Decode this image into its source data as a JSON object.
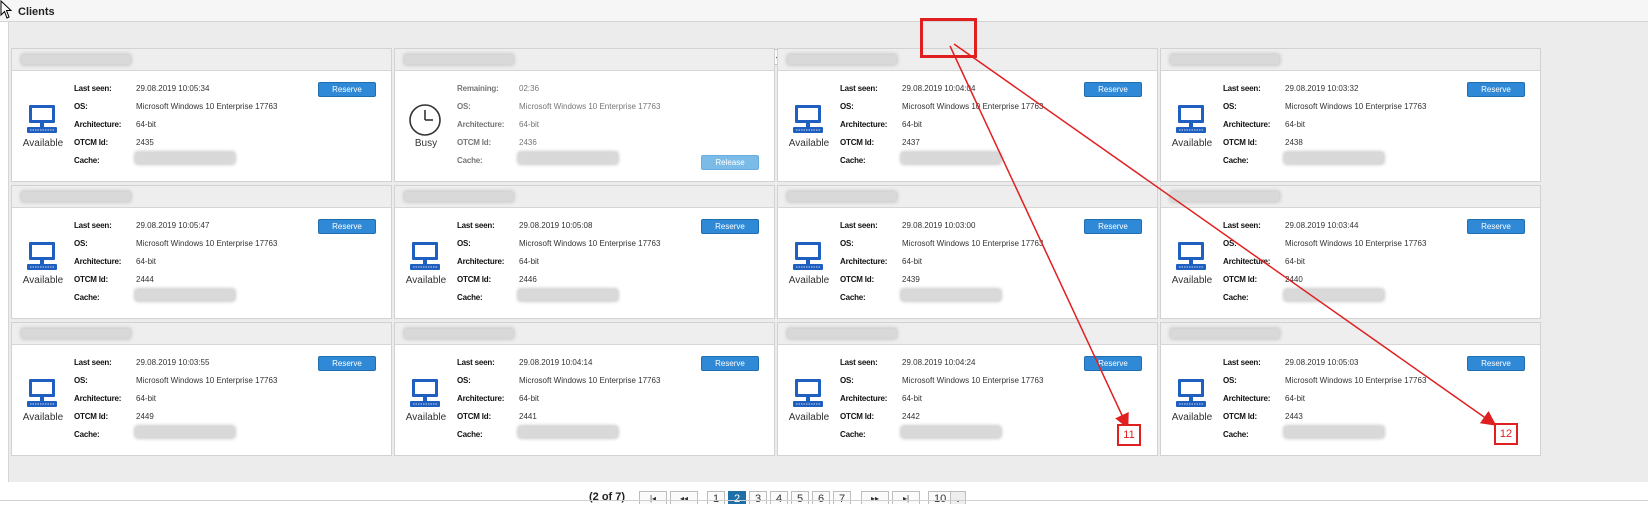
{
  "panel": {
    "title": "Clients"
  },
  "pager": {
    "info": "(2 of 7)",
    "first": "|◂",
    "prev": "◂◂",
    "pages": [
      "1",
      "2",
      "3",
      "4",
      "5",
      "6",
      "7"
    ],
    "active_page": "2",
    "next": "▸▸",
    "last": "▸|",
    "page_size": "10"
  },
  "labels": {
    "last_seen": "Last seen:",
    "remaining": "Remaining:",
    "os": "OS:",
    "arch": "Architecture:",
    "otcm": "OTCM Id:",
    "cache": "Cache:",
    "reserve": "Reserve",
    "release": "Release"
  },
  "cards": [
    {
      "status": "Available",
      "time": "29.08.2019 10:05:34",
      "os": "Microsoft Windows 10 Enterprise 17763",
      "arch": "64-bit",
      "otcm": "2435"
    },
    {
      "status": "Busy",
      "time": "02:36",
      "os": "Microsoft Windows 10 Enterprise 17763",
      "arch": "64-bit",
      "otcm": "2436"
    },
    {
      "status": "Available",
      "time": "29.08.2019 10:04:04",
      "os": "Microsoft Windows 10 Enterprise 17763",
      "arch": "64-bit",
      "otcm": "2437"
    },
    {
      "status": "Available",
      "time": "29.08.2019 10:03:32",
      "os": "Microsoft Windows 10 Enterprise 17763",
      "arch": "64-bit",
      "otcm": "2438"
    },
    {
      "status": "Available",
      "time": "29.08.2019 10:05:47",
      "os": "Microsoft Windows 10 Enterprise 17763",
      "arch": "64-bit",
      "otcm": "2444"
    },
    {
      "status": "Available",
      "time": "29.08.2019 10:05:08",
      "os": "Microsoft Windows 10 Enterprise 17763",
      "arch": "64-bit",
      "otcm": "2446"
    },
    {
      "status": "Available",
      "time": "29.08.2019 10:03:00",
      "os": "Microsoft Windows 10 Enterprise 17763",
      "arch": "64-bit",
      "otcm": "2439"
    },
    {
      "status": "Available",
      "time": "29.08.2019 10:03:44",
      "os": "Microsoft Windows 10 Enterprise 17763",
      "arch": "64-bit",
      "otcm": "2440"
    },
    {
      "status": "Available",
      "time": "29.08.2019 10:03:55",
      "os": "Microsoft Windows 10 Enterprise 17763",
      "arch": "64-bit",
      "otcm": "2449"
    },
    {
      "status": "Available",
      "time": "29.08.2019 10:04:14",
      "os": "Microsoft Windows 10 Enterprise 17763",
      "arch": "64-bit",
      "otcm": "2441"
    },
    {
      "status": "Available",
      "time": "29.08.2019 10:04:24",
      "os": "Microsoft Windows 10 Enterprise 17763",
      "arch": "64-bit",
      "otcm": "2442"
    },
    {
      "status": "Available",
      "time": "29.08.2019 10:05:03",
      "os": "Microsoft Windows 10 Enterprise 17763",
      "arch": "64-bit",
      "otcm": "2443"
    }
  ],
  "annotations": {
    "label_a": "11",
    "label_b": "12"
  },
  "colors": {
    "accent": "#1e6fa6",
    "button": "#2f89d6",
    "annotation": "#e02020",
    "icon": "#1f5fbf"
  }
}
